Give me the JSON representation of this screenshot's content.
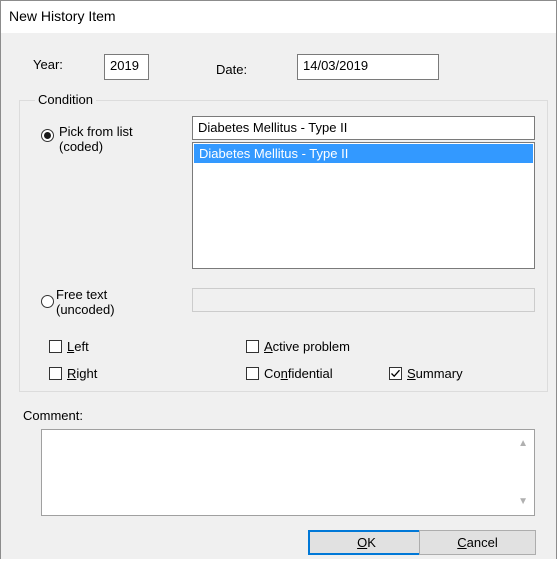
{
  "window": {
    "title": "New History Item"
  },
  "year": {
    "label": "Year:",
    "value": "2019"
  },
  "date": {
    "label": "Date:",
    "value": "14/03/2019"
  },
  "condition": {
    "legend": "Condition",
    "pick_from_list": {
      "line1": "Pick from list",
      "line2": "(coded)",
      "checked": true
    },
    "selected_text": "Diabetes Mellitus - Type II",
    "list_items": [
      "Diabetes Mellitus - Type II"
    ],
    "free_text": {
      "line1": "Free text",
      "line2": "(uncoded)",
      "checked": false,
      "value": ""
    },
    "checkboxes": {
      "left": {
        "accel": "L",
        "rest": "eft",
        "checked": false
      },
      "right": {
        "accel": "R",
        "rest": "ight",
        "checked": false
      },
      "active_problem": {
        "accel": "A",
        "rest": "ctive problem",
        "checked": false
      },
      "confidential": {
        "pre": "Co",
        "accel": "n",
        "rest": "fidential",
        "checked": false
      },
      "summary": {
        "accel": "S",
        "rest": "ummary",
        "checked": true
      }
    }
  },
  "comment": {
    "label": "Comment:",
    "value": ""
  },
  "buttons": {
    "ok": {
      "accel": "O",
      "rest": "K"
    },
    "cancel": {
      "accel": "C",
      "rest": "ancel"
    }
  }
}
